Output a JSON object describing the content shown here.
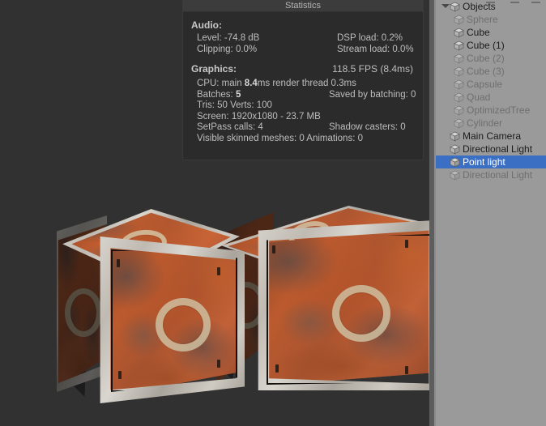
{
  "window": {
    "title": "Unity Editor - Game View with Statistics",
    "scene_background": "#313131",
    "hierarchy_background": "#9a9a9a",
    "selection_color": "#3a6fc4"
  },
  "statistics": {
    "title": "Statistics",
    "audio": {
      "heading": "Audio:",
      "level_label": "Level: -74.8 dB",
      "dsp_label": "DSP load: 0.2%",
      "clipping_label": "Clipping: 0.0%",
      "stream_label": "Stream load: 0.0%"
    },
    "graphics": {
      "heading": "Graphics:",
      "fps": "118.5 FPS (8.4ms)",
      "cpu_prefix": "CPU: main ",
      "cpu_main": "8.4",
      "cpu_suffix": "ms  render thread 0.3ms",
      "batches_prefix": "Batches: ",
      "batches_value": "5",
      "saved_by_batching": "Saved by batching: 0",
      "tris_verts": "Tris: 50   Verts: 100",
      "screen": "Screen: 1920x1080 - 23.7 MB",
      "setpass": "SetPass calls: 4",
      "shadow_casters": "Shadow casters: 0",
      "skinned_animations": "Visible skinned meshes: 0  Animations: 0"
    }
  },
  "hierarchy": {
    "items": [
      {
        "label": "Objects",
        "indent": 0,
        "expanded": true,
        "dim": false,
        "selected": false,
        "icon": "cube-icon"
      },
      {
        "label": "Sphere",
        "indent": 1,
        "expanded": false,
        "dim": true,
        "selected": false,
        "icon": "cube-icon"
      },
      {
        "label": "Cube",
        "indent": 1,
        "expanded": false,
        "dim": false,
        "selected": false,
        "icon": "cube-icon"
      },
      {
        "label": "Cube (1)",
        "indent": 1,
        "expanded": false,
        "dim": false,
        "selected": false,
        "icon": "cube-icon"
      },
      {
        "label": "Cube (2)",
        "indent": 1,
        "expanded": false,
        "dim": true,
        "selected": false,
        "icon": "cube-icon"
      },
      {
        "label": "Cube (3)",
        "indent": 1,
        "expanded": false,
        "dim": true,
        "selected": false,
        "icon": "cube-icon"
      },
      {
        "label": "Capsule",
        "indent": 1,
        "expanded": false,
        "dim": true,
        "selected": false,
        "icon": "cube-icon"
      },
      {
        "label": "Quad",
        "indent": 1,
        "expanded": false,
        "dim": true,
        "selected": false,
        "icon": "cube-icon"
      },
      {
        "label": "OptimizedTree",
        "indent": 1,
        "expanded": false,
        "dim": true,
        "selected": false,
        "icon": "cube-icon"
      },
      {
        "label": "Cylinder",
        "indent": 1,
        "expanded": false,
        "dim": true,
        "selected": false,
        "icon": "cube-icon"
      },
      {
        "label": "Main Camera",
        "indent": 0,
        "expanded": false,
        "dim": false,
        "selected": false,
        "icon": "cube-icon"
      },
      {
        "label": "Directional Light",
        "indent": 0,
        "expanded": false,
        "dim": false,
        "selected": false,
        "icon": "cube-icon"
      },
      {
        "label": "Point light",
        "indent": 0,
        "expanded": false,
        "dim": false,
        "selected": true,
        "icon": "cube-icon"
      },
      {
        "label": "Directional Light",
        "indent": 0,
        "expanded": false,
        "dim": true,
        "selected": false,
        "icon": "cube-icon"
      }
    ]
  },
  "scene": {
    "objects": [
      {
        "name": "crate-front",
        "type": "rusty-metal-crate"
      },
      {
        "name": "crate-back",
        "type": "rusty-metal-crate"
      }
    ]
  }
}
